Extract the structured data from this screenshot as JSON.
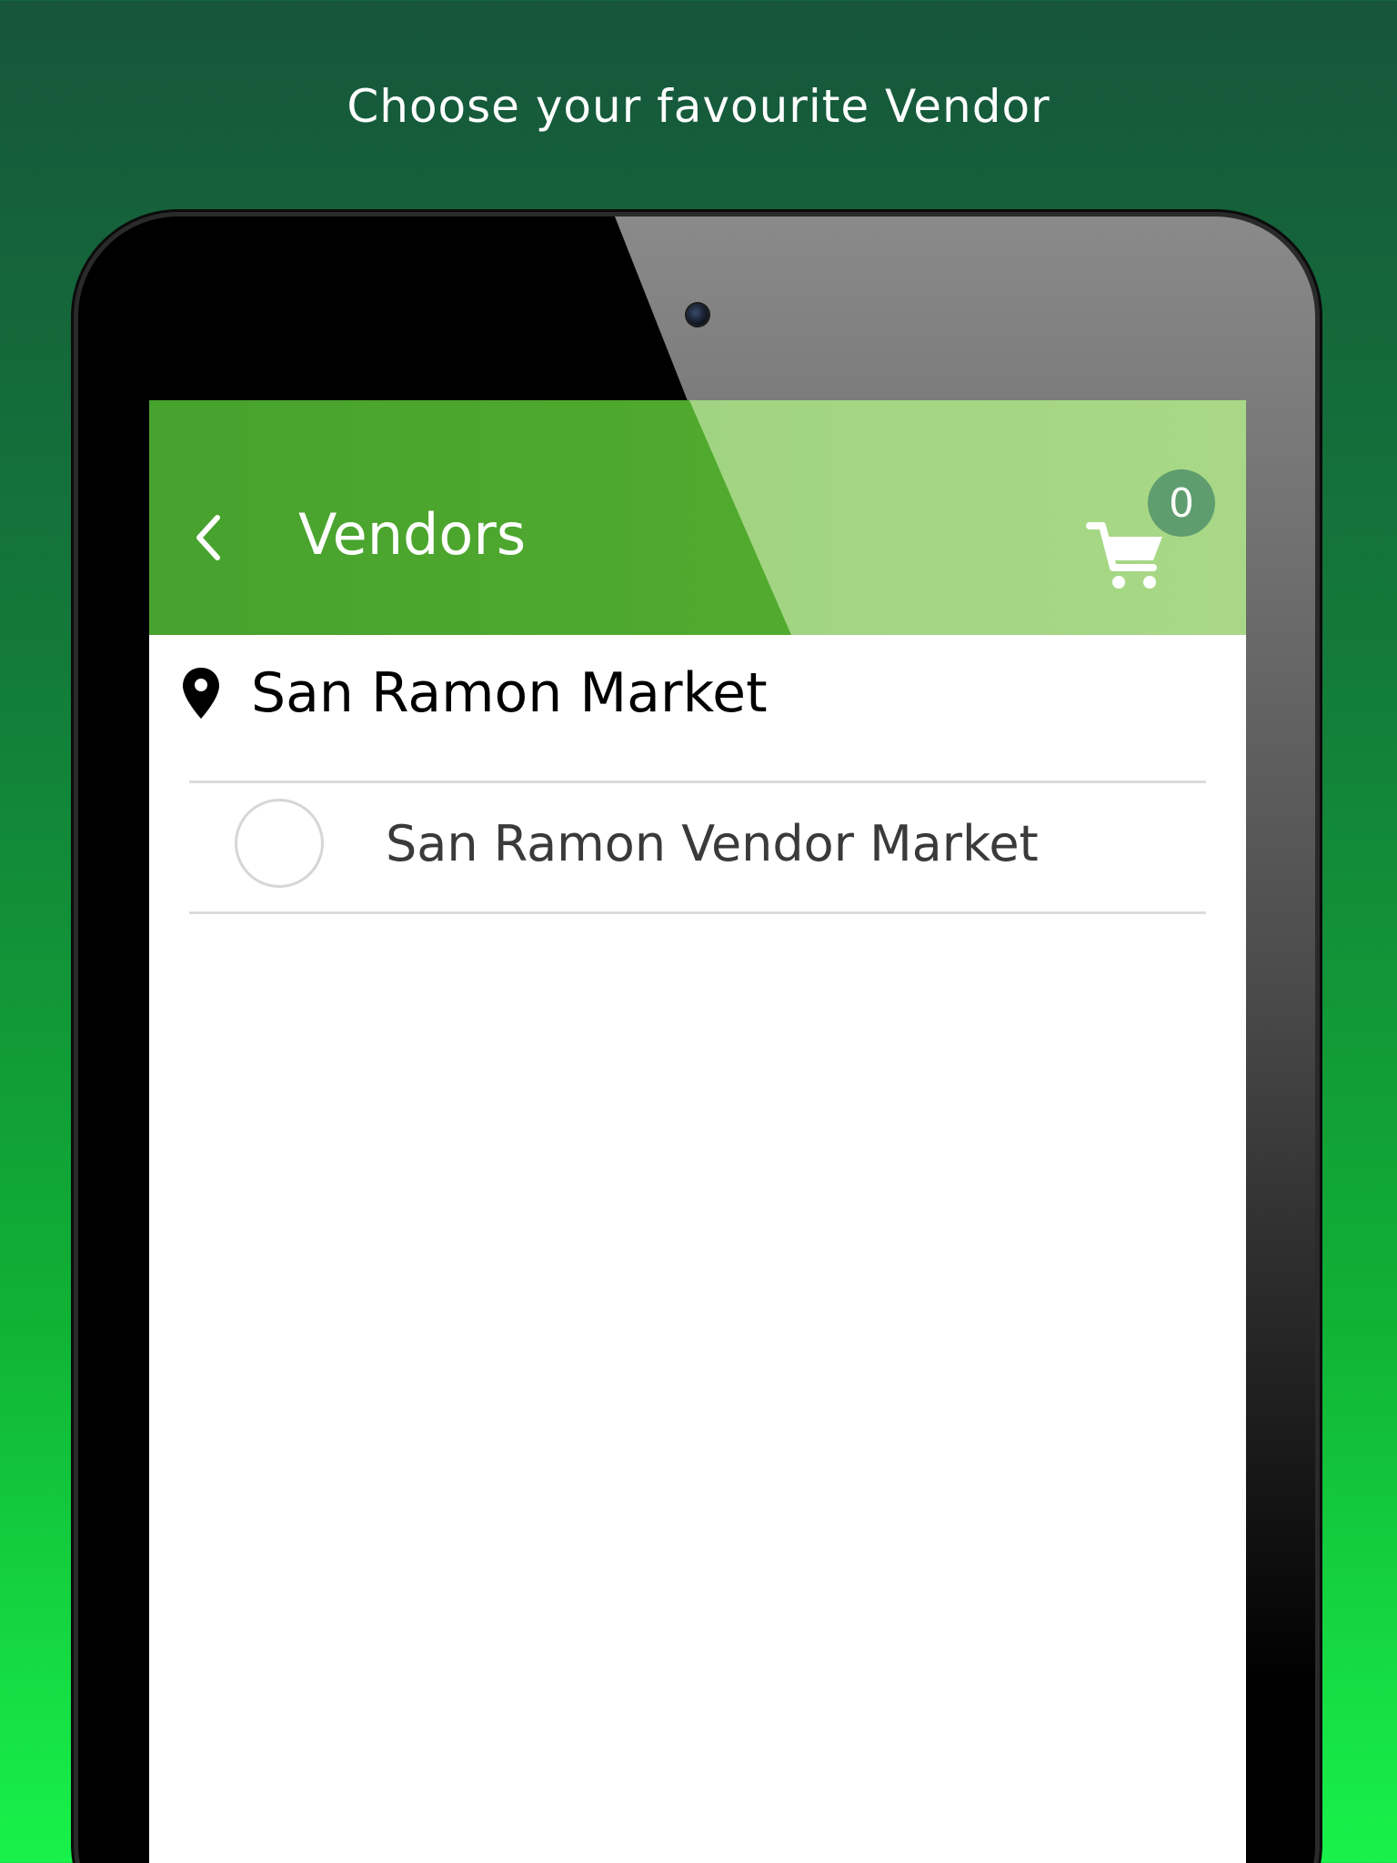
{
  "promo": {
    "caption": "Choose your favourite Vendor"
  },
  "app_bar": {
    "title": "Vendors",
    "back_icon": "chevron-left-icon",
    "cart_icon": "shopping-cart-icon",
    "cart_count": "0"
  },
  "location": {
    "icon": "location-pin-icon",
    "name": "San Ramon Market"
  },
  "vendors": [
    {
      "name": "San Ramon Vendor Market",
      "selected": false
    }
  ],
  "colors": {
    "app_bar_green": "#4fa82f",
    "badge": "#5c9a6e",
    "background_top": "#16553b",
    "background_bottom": "#18f24a"
  }
}
